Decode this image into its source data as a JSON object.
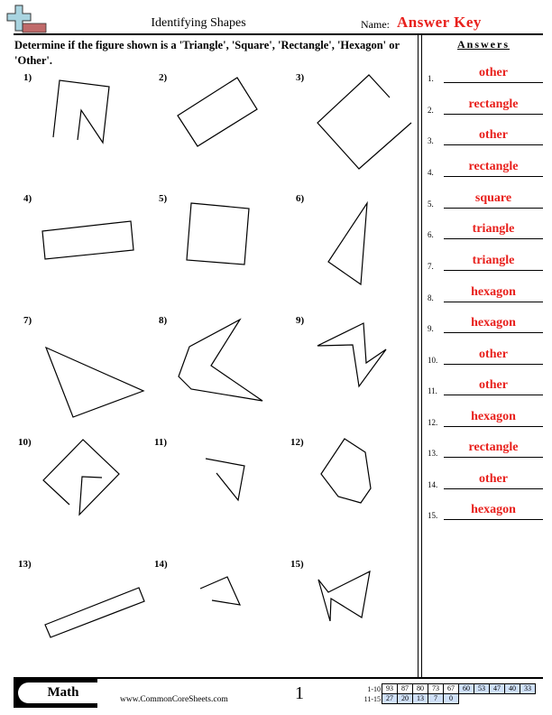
{
  "header": {
    "title": "Identifying Shapes",
    "name_label": "Name:",
    "answer_key": "Answer Key",
    "logo_icon": "math-plus-minus-logo"
  },
  "instructions": "Determine if the figure shown is a 'Triangle', 'Square', 'Rectangle', 'Hexagon' or 'Other'.",
  "answers_heading": "Answers",
  "questions": [
    {
      "label": "1)"
    },
    {
      "label": "2)"
    },
    {
      "label": "3)"
    },
    {
      "label": "4)"
    },
    {
      "label": "5)"
    },
    {
      "label": "6)"
    },
    {
      "label": "7)"
    },
    {
      "label": "8)"
    },
    {
      "label": "9)"
    },
    {
      "label": "10)"
    },
    {
      "label": "11)"
    },
    {
      "label": "12)"
    },
    {
      "label": "13)"
    },
    {
      "label": "14)"
    },
    {
      "label": "15)"
    }
  ],
  "answers": [
    {
      "num": "1.",
      "value": "other"
    },
    {
      "num": "2.",
      "value": "rectangle"
    },
    {
      "num": "3.",
      "value": "other"
    },
    {
      "num": "4.",
      "value": "rectangle"
    },
    {
      "num": "5.",
      "value": "square"
    },
    {
      "num": "6.",
      "value": "triangle"
    },
    {
      "num": "7.",
      "value": "triangle"
    },
    {
      "num": "8.",
      "value": "hexagon"
    },
    {
      "num": "9.",
      "value": "hexagon"
    },
    {
      "num": "10.",
      "value": "other"
    },
    {
      "num": "11.",
      "value": "other"
    },
    {
      "num": "12.",
      "value": "hexagon"
    },
    {
      "num": "13.",
      "value": "rectangle"
    },
    {
      "num": "14.",
      "value": "other"
    },
    {
      "num": "15.",
      "value": "hexagon"
    }
  ],
  "footer": {
    "subject": "Math",
    "site": "www.CommonCoreSheets.com",
    "page": "1",
    "score_rows": [
      {
        "label": "1-10",
        "cells": [
          "93",
          "87",
          "80",
          "73",
          "67",
          "60",
          "53",
          "47",
          "40",
          "33"
        ]
      },
      {
        "label": "11-15",
        "cells": [
          "27",
          "20",
          "13",
          "7",
          "0"
        ]
      }
    ]
  }
}
